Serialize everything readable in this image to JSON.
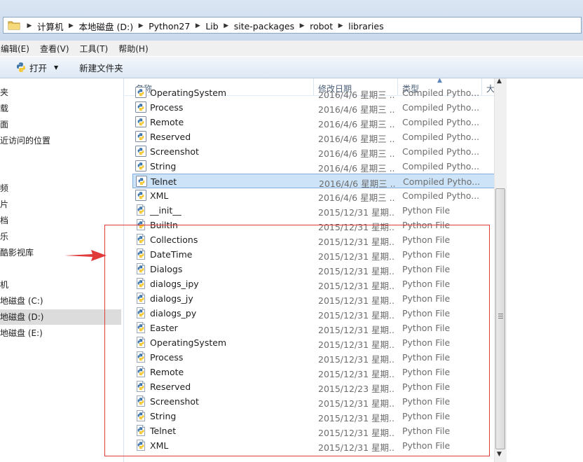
{
  "breadcrumb": [
    "计算机",
    "本地磁盘 (D:)",
    "Python27",
    "Lib",
    "site-packages",
    "robot",
    "libraries"
  ],
  "menu": [
    "编辑(E)",
    "查看(V)",
    "工具(T)",
    "帮助(H)"
  ],
  "toolbar": {
    "open_label": "打开",
    "new_folder_label": "新建文件夹"
  },
  "nav": [
    "夹",
    "载",
    "面",
    "近访问的位置",
    "频",
    "片",
    "档",
    "乐",
    "酷影视库",
    "机",
    "地磁盘 (C:)",
    "地磁盘 (D:)",
    "地磁盘 (E:)"
  ],
  "columns": {
    "name": "名称",
    "date": "修改日期",
    "type": "类型",
    "size": "大"
  },
  "files": [
    {
      "name": "OperatingSystem",
      "date": "2016/4/6 星期三 ...",
      "type": "Compiled Pytho...",
      "icon": "compiled-python-icon"
    },
    {
      "name": "Process",
      "date": "2016/4/6 星期三 ...",
      "type": "Compiled Pytho...",
      "icon": "compiled-python-icon"
    },
    {
      "name": "Remote",
      "date": "2016/4/6 星期三 ...",
      "type": "Compiled Pytho...",
      "icon": "compiled-python-icon"
    },
    {
      "name": "Reserved",
      "date": "2016/4/6 星期三 ...",
      "type": "Compiled Pytho...",
      "icon": "compiled-python-icon"
    },
    {
      "name": "Screenshot",
      "date": "2016/4/6 星期三 ...",
      "type": "Compiled Pytho...",
      "icon": "compiled-python-icon"
    },
    {
      "name": "String",
      "date": "2016/4/6 星期三 ...",
      "type": "Compiled Pytho...",
      "icon": "compiled-python-icon"
    },
    {
      "name": "Telnet",
      "date": "2016/4/6 星期三 ...",
      "type": "Compiled Pytho...",
      "icon": "compiled-python-icon",
      "selected": true
    },
    {
      "name": "XML",
      "date": "2016/4/6 星期三 ...",
      "type": "Compiled Pytho...",
      "icon": "compiled-python-icon"
    },
    {
      "name": "__init__",
      "date": "2015/12/31 星期...",
      "type": "Python File",
      "icon": "python-file-icon"
    },
    {
      "name": "BuiltIn",
      "date": "2015/12/31 星期...",
      "type": "Python File",
      "icon": "python-file-icon"
    },
    {
      "name": "Collections",
      "date": "2015/12/31 星期...",
      "type": "Python File",
      "icon": "python-file-icon"
    },
    {
      "name": "DateTime",
      "date": "2015/12/31 星期...",
      "type": "Python File",
      "icon": "python-file-icon"
    },
    {
      "name": "Dialogs",
      "date": "2015/12/31 星期...",
      "type": "Python File",
      "icon": "python-file-icon"
    },
    {
      "name": "dialogs_ipy",
      "date": "2015/12/31 星期...",
      "type": "Python File",
      "icon": "python-file-icon"
    },
    {
      "name": "dialogs_jy",
      "date": "2015/12/31 星期...",
      "type": "Python File",
      "icon": "python-file-icon"
    },
    {
      "name": "dialogs_py",
      "date": "2015/12/31 星期...",
      "type": "Python File",
      "icon": "python-file-icon"
    },
    {
      "name": "Easter",
      "date": "2015/12/31 星期...",
      "type": "Python File",
      "icon": "python-file-icon"
    },
    {
      "name": "OperatingSystem",
      "date": "2015/12/31 星期...",
      "type": "Python File",
      "icon": "python-file-icon"
    },
    {
      "name": "Process",
      "date": "2015/12/31 星期...",
      "type": "Python File",
      "icon": "python-file-icon"
    },
    {
      "name": "Remote",
      "date": "2015/12/31 星期...",
      "type": "Python File",
      "icon": "python-file-icon"
    },
    {
      "name": "Reserved",
      "date": "2015/12/23 星期...",
      "type": "Python File",
      "icon": "python-file-icon"
    },
    {
      "name": "Screenshot",
      "date": "2015/12/31 星期...",
      "type": "Python File",
      "icon": "python-file-icon"
    },
    {
      "name": "String",
      "date": "2015/12/31 星期...",
      "type": "Python File",
      "icon": "python-file-icon"
    },
    {
      "name": "Telnet",
      "date": "2015/12/31 星期...",
      "type": "Python File",
      "icon": "python-file-icon"
    },
    {
      "name": "XML",
      "date": "2015/12/31 星期...",
      "type": "Python File",
      "icon": "python-file-icon"
    }
  ],
  "colors": {
    "selection_bg": "#cde3f8",
    "selection_border": "#84acdd",
    "annotation": "#e03a3a"
  }
}
